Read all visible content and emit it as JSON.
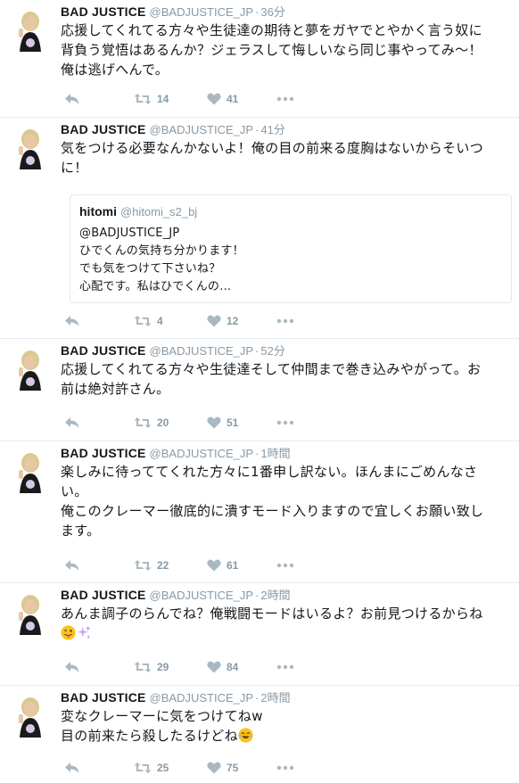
{
  "icons": {
    "reply": "reply-icon",
    "retweet": "retweet-icon",
    "like": "heart-icon",
    "more": "more-icon"
  },
  "colors": {
    "action_gray": "#8899a6",
    "text": "#14171a",
    "border": "#e6ecf0"
  },
  "tweets": [
    {
      "name": "BAD JUSTICE",
      "handle": "@BADJUSTICE_JP",
      "time": "36分",
      "lines": [
        "応援してくれてる方々や生徒達の期待と夢をガヤでとやかく言う奴に",
        "背負う覚悟はあるんか？ジェラスして悔しいなら同じ事やってみ〜！",
        "俺は逃げへんで。"
      ],
      "retweets": "14",
      "likes": "41"
    },
    {
      "name": "BAD JUSTICE",
      "handle": "@BADJUSTICE_JP",
      "time": "41分",
      "lines": [
        "気をつける必要なんかないよ！俺の目の前来る度胸はないからそいつ",
        "に！"
      ],
      "quote": {
        "name": "hitomi",
        "handle": "@hitomi_s2_bj",
        "lines": [
          "@BADJUSTICE_JP",
          "ひでくんの気持ち分かります！",
          "でも気をつけて下さいね？",
          "心配です。私はひでくんの…"
        ]
      },
      "retweets": "4",
      "likes": "12"
    },
    {
      "name": "BAD JUSTICE",
      "handle": "@BADJUSTICE_JP",
      "time": "52分",
      "lines": [
        "応援してくれてる方々や生徒達そして仲間まで巻き込みやがって。お",
        "前は絶対許さん。"
      ],
      "retweets": "20",
      "likes": "51"
    },
    {
      "name": "BAD JUSTICE",
      "handle": "@BADJUSTICE_JP",
      "time": "1時間",
      "lines": [
        "楽しみに待っててくれた方々に1番申し訳ない。ほんまにごめんなさ",
        "い。",
        "俺このクレーマー徹底的に潰すモード入りますので宜しくお願い致し",
        "ます。"
      ],
      "retweets": "22",
      "likes": "61"
    },
    {
      "name": "BAD JUSTICE",
      "handle": "@BADJUSTICE_JP",
      "time": "2時間",
      "lines": [
        "あんま調子のらんでね？俺戦闘モードはいるよ？お前見つけるからね"
      ],
      "emoji_line": [
        "tongue-wink-emoji",
        "sparkles-emoji"
      ],
      "retweets": "29",
      "likes": "84"
    },
    {
      "name": "BAD JUSTICE",
      "handle": "@BADJUSTICE_JP",
      "time": "2時間",
      "lines": [
        "変なクレーマーに気をつけてねw",
        "目の前来たら殺したるけどね"
      ],
      "trailing_emoji": "tears-of-joy-emoji",
      "retweets": "25",
      "likes": "75"
    }
  ]
}
